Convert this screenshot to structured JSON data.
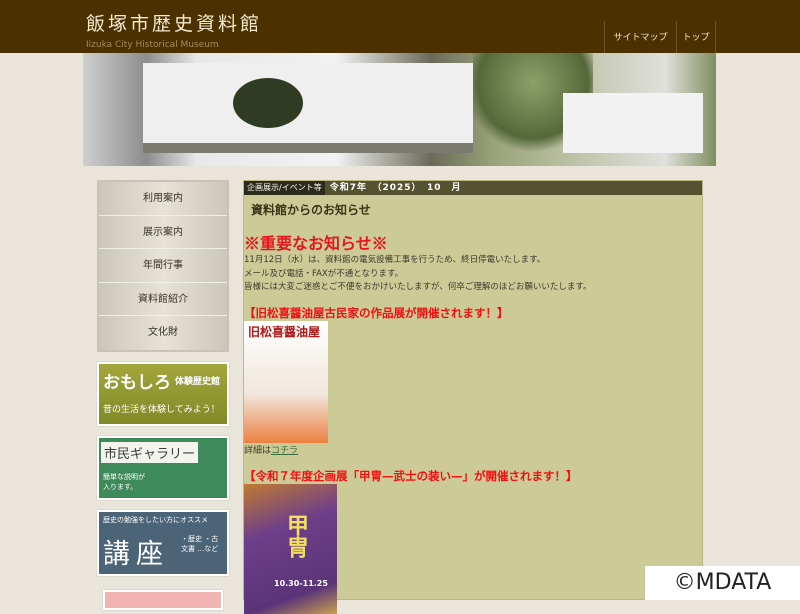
{
  "header": {
    "title": "飯塚市歴史資料館",
    "subtitle": "Iizuka City Historical Museum",
    "nav": [
      {
        "label": "サイトマップ"
      },
      {
        "label": "トップ"
      }
    ]
  },
  "sidebar": {
    "menu": [
      {
        "label": "利用案内"
      },
      {
        "label": "展示案内"
      },
      {
        "label": "年間行事"
      },
      {
        "label": "資料館紹介"
      },
      {
        "label": "文化財"
      }
    ],
    "banners": [
      {
        "title": "おもしろ",
        "sub": "体験歴史館",
        "caption": "昔の生活を体験してみよう！"
      },
      {
        "title": "市民ギャラリー",
        "caption": "簡単な説明が入ります。"
      },
      {
        "top": "歴史の勉強をしたい方にオススメ",
        "title": "講座",
        "items": "・歴史 ・古文書 …など"
      }
    ]
  },
  "content": {
    "tag": "企画展示/イベント等",
    "date": "令和7年　（2025）　10　月",
    "heading": "資料館からのお知らせ",
    "important": "※重要なお知らせ※",
    "notice": [
      "11月12日（水）は、資料館の電気設備工事を行うため、終日停電いたします。",
      "メール及び電話・FAXが不通となります。",
      "皆様には大変ご迷惑とご不便をおかけいたしますが、何卒ご理解のほどお願いいたします。"
    ],
    "event1": {
      "title": "【旧松喜醤油屋古民家の作品展が開催されます！】",
      "poster_title": "旧松喜醤油屋",
      "details_prefix": "詳細は",
      "details_link": "コチラ"
    },
    "event2": {
      "title": "【令和７年度企画展「甲冑—武士の装い—」が開催されます！】",
      "poster_title": "甲冑",
      "poster_dates": "10.30-11.25"
    }
  },
  "watermark": "©MDATA"
}
